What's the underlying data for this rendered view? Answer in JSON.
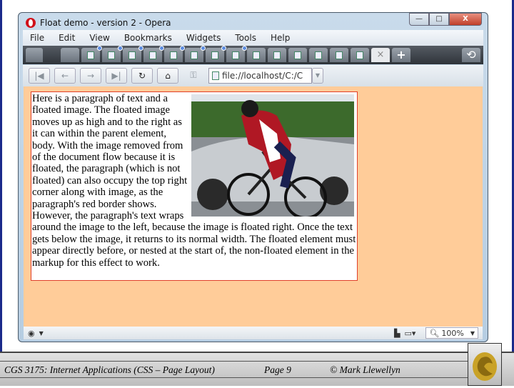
{
  "window": {
    "title": "Float demo - version 2 - Opera",
    "minimize": "—",
    "maximize": "□",
    "close": "X"
  },
  "menu": [
    "File",
    "Edit",
    "View",
    "Bookmarks",
    "Widgets",
    "Tools",
    "Help"
  ],
  "tabs": {
    "count_with_dot": 8,
    "count_plain": 6,
    "active_close": "×",
    "new_tab": "+",
    "overflow": "• • •"
  },
  "nav": {
    "first": "|◀",
    "back": "←",
    "forward": "→",
    "last": "▶|",
    "reload": "↻",
    "home": "⌂",
    "key": "⚿",
    "address": "file://localhost/C:/C",
    "dropdown": "▼"
  },
  "page": {
    "paragraph": "Here is a paragraph of text and a floated image. The floated image moves up as high and to the right as it can within the parent element, body. With the image removed from of the document flow because it is floated, the paragraph (which is not floated) can also occupy the top right corner along with image, as the paragraph's red border shows. However, the paragraph's text wraps around the image to the left, because the image is floated right. Once the text gets below the image, it returns to its normal width. The floated element must appear directly before, or nested at the start of, the non-floated element in the markup for this effect to work."
  },
  "status": {
    "zoom": "100%",
    "dropdown": "▼"
  },
  "footer": {
    "course": "CGS 3175: Internet Applications (CSS – Page Layout)",
    "page": "Page 9",
    "author": "© Mark Llewellyn"
  },
  "colors": {
    "content_bg": "#ffcc99",
    "para_border": "#e0402a"
  }
}
